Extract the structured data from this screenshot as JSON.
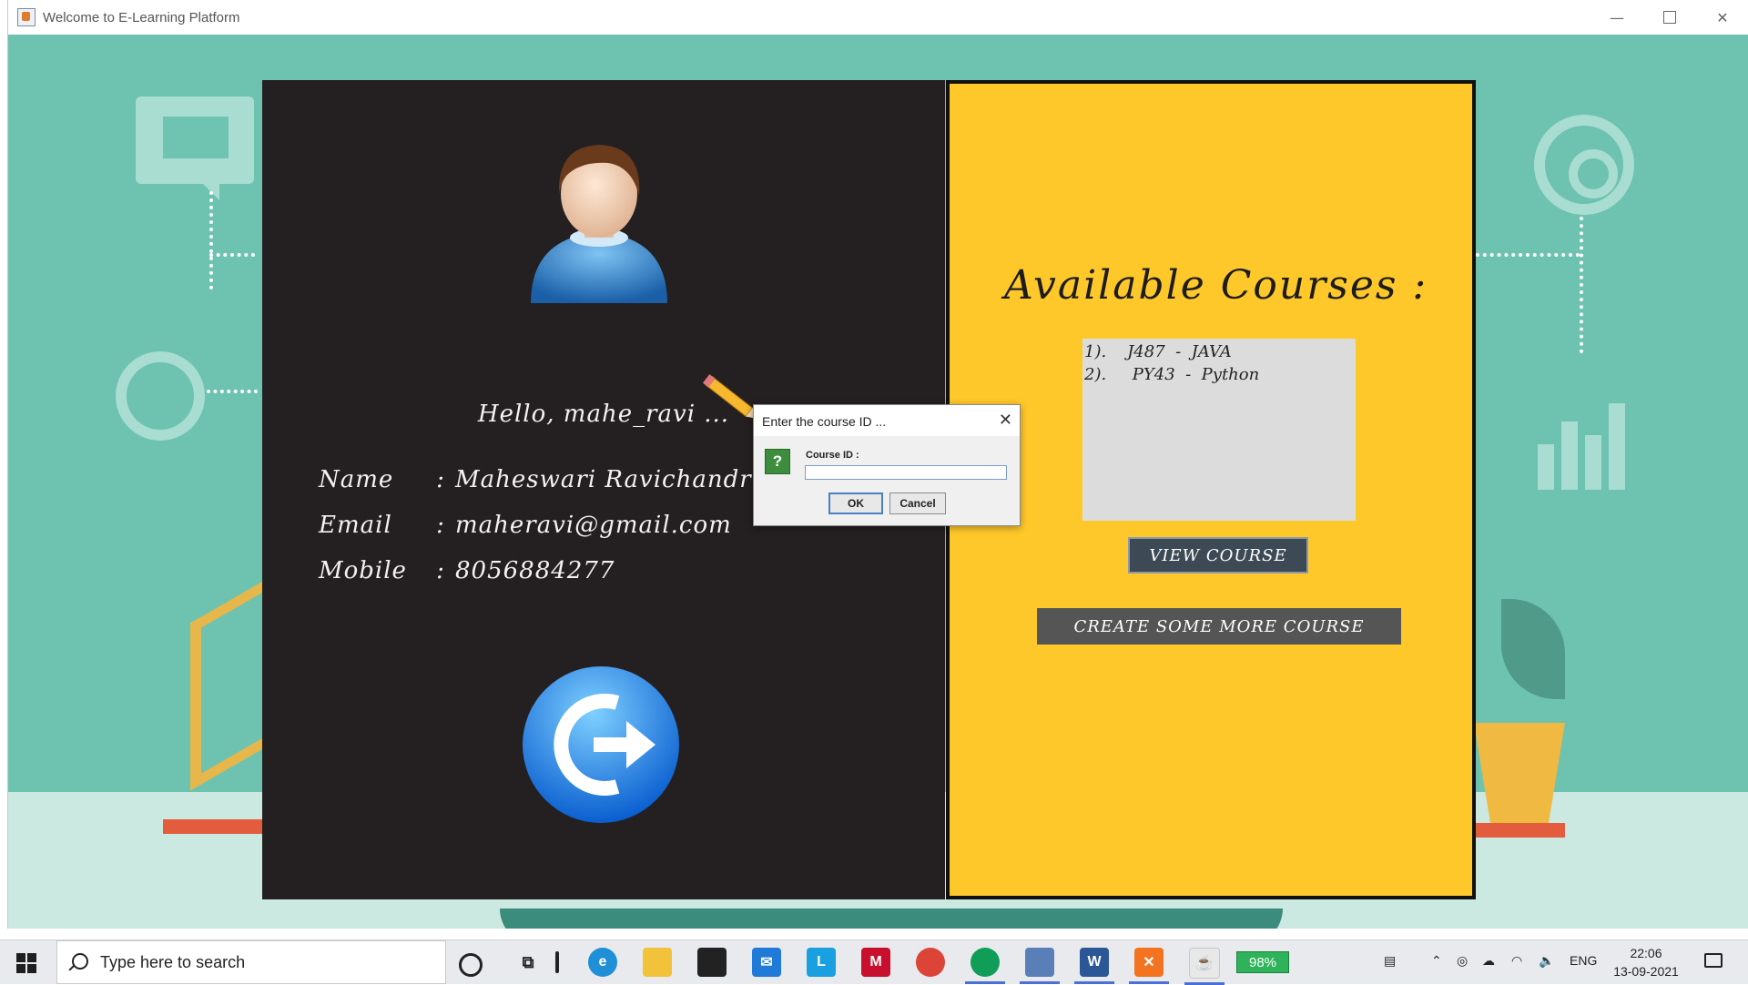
{
  "window": {
    "title": "Welcome to E-Learning Platform",
    "minimize": "—",
    "close": "✕"
  },
  "profile": {
    "greeting": "Hello, mahe_ravi ...",
    "name_label": "Name",
    "name_value": "Maheswari Ravichandr",
    "email_label": "Email",
    "email_value": "maheravi@gmail.com",
    "mobile_label": "Mobile",
    "mobile_value": "8056884277",
    "separator": ":"
  },
  "courses": {
    "title": "Available Courses :",
    "items": [
      "1).    J487  -  JAVA",
      "2).     PY43  -  Python"
    ],
    "view_button": "VIEW COURSE",
    "create_button": "CREATE SOME MORE COURSE"
  },
  "dialog": {
    "title": "Enter the course ID ...",
    "close": "✕",
    "icon": "?",
    "label": "Course ID :",
    "input_value": "",
    "ok": "OK",
    "cancel": "Cancel"
  },
  "taskbar": {
    "search_placeholder": "Type here to search",
    "battery": "98%",
    "language": "ENG",
    "time": "22:06",
    "date": "13-09-2021",
    "apps": [
      "edge-icon",
      "file-explorer-icon",
      "store-icon",
      "mail-icon",
      "l-app-icon",
      "mcafee-icon",
      "chrome-icon",
      "chrome-profile-icon",
      "virtualbox-icon",
      "word-icon",
      "xampp-icon",
      "java-icon"
    ]
  },
  "colors": {
    "background": "#6ec2b0",
    "left_panel": "#241f20",
    "right_panel": "#ffc82a",
    "view_button": "#3d4a55",
    "create_button": "#555555"
  }
}
